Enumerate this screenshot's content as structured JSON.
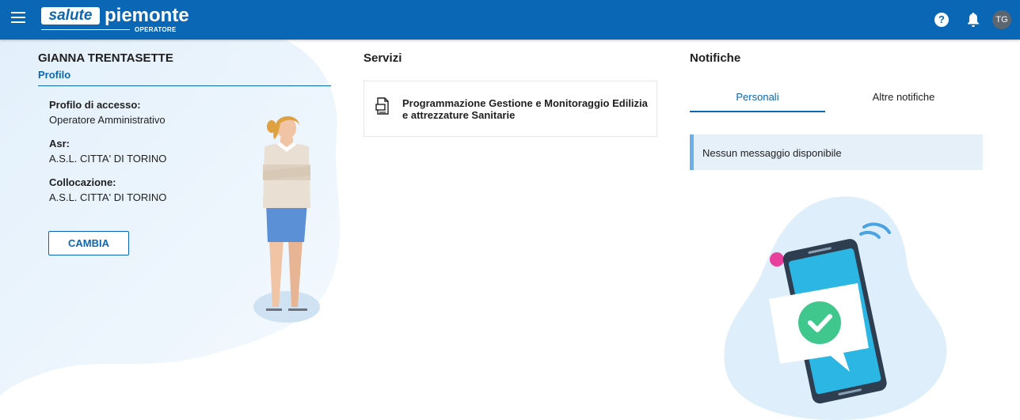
{
  "header": {
    "logo_main": "salute",
    "logo_word": "piemonte",
    "logo_sub": "OPERATORE",
    "help_symbol": "?",
    "avatar_initials": "TG",
    "icons": [
      "menu-icon",
      "help-icon",
      "bell-icon"
    ]
  },
  "profile": {
    "name": "GIANNA TRENTASETTE",
    "subtitle": "Profilo",
    "fields": [
      {
        "label": "Profilo di accesso:",
        "value": "Operatore Amministrativo"
      },
      {
        "label": "Asr:",
        "value": "A.S.L. CITTA' DI TORINO"
      },
      {
        "label": "Collocazione:",
        "value": "A.S.L. CITTA' DI TORINO"
      }
    ],
    "change_button": "CAMBIA"
  },
  "services": {
    "title": "Servizi",
    "items": [
      {
        "label": "Programmazione Gestione e Monitoraggio Edilizia e attrezzature Sanitarie",
        "icon": "document-icon"
      }
    ]
  },
  "notifications": {
    "title": "Notifiche",
    "tabs": [
      {
        "label": "Personali",
        "active": true
      },
      {
        "label": "Altre notifiche",
        "active": false
      }
    ],
    "empty_message": "Nessun messaggio disponibile"
  },
  "colors": {
    "primary": "#0a67b6",
    "notice_bg": "#e6f0f9",
    "notice_border": "#6bb0ea",
    "success": "#3fc78d",
    "phone_screen": "#2bb6e3"
  }
}
